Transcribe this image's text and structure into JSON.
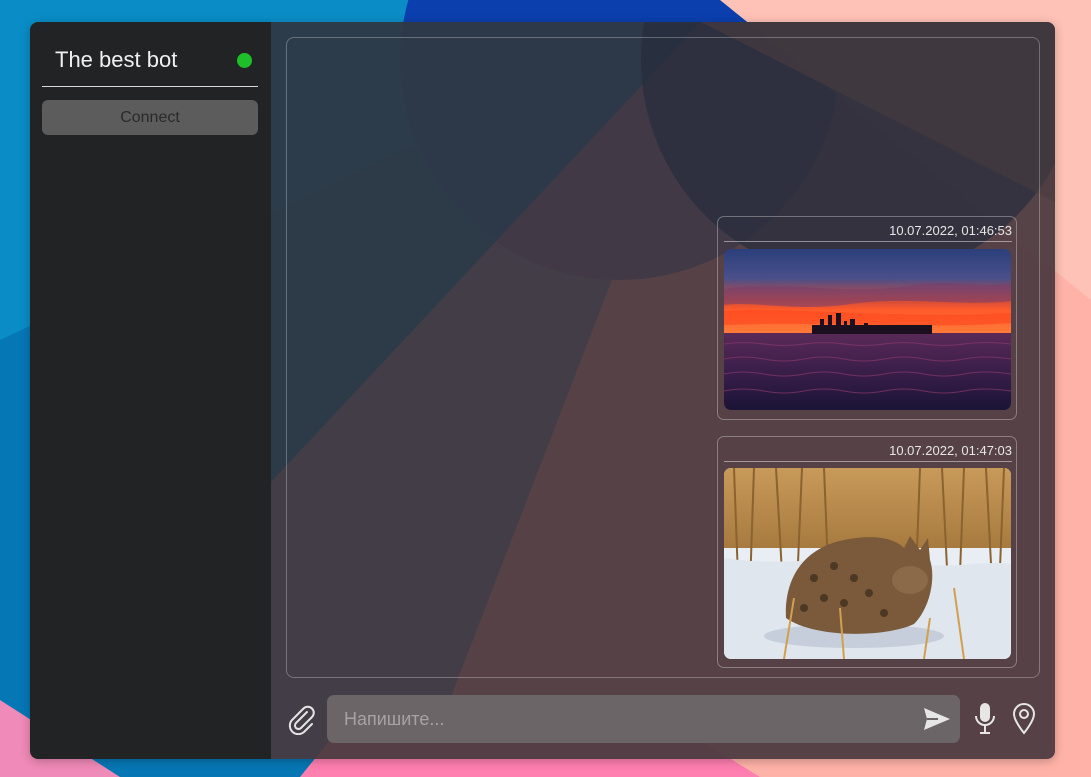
{
  "sidebar": {
    "bot_name": "The best bot",
    "status": "online",
    "status_color": "#1fbf2c",
    "connect_label": "Connect"
  },
  "chat": {
    "messages": [
      {
        "timestamp": "10.07.2022, 01:46:53",
        "image": "sunset-city-skyline-over-water"
      },
      {
        "timestamp": "10.07.2022, 01:47:03",
        "image": "wild-cat-in-snowy-field"
      }
    ]
  },
  "composer": {
    "placeholder": "Напишите...",
    "icons": [
      "paperclip-icon",
      "send-icon",
      "microphone-icon",
      "location-pin-icon"
    ]
  },
  "colors": {
    "sidebar_bg": "#222324",
    "chat_bg": "#48383e",
    "input_bg": "#6c6567"
  }
}
